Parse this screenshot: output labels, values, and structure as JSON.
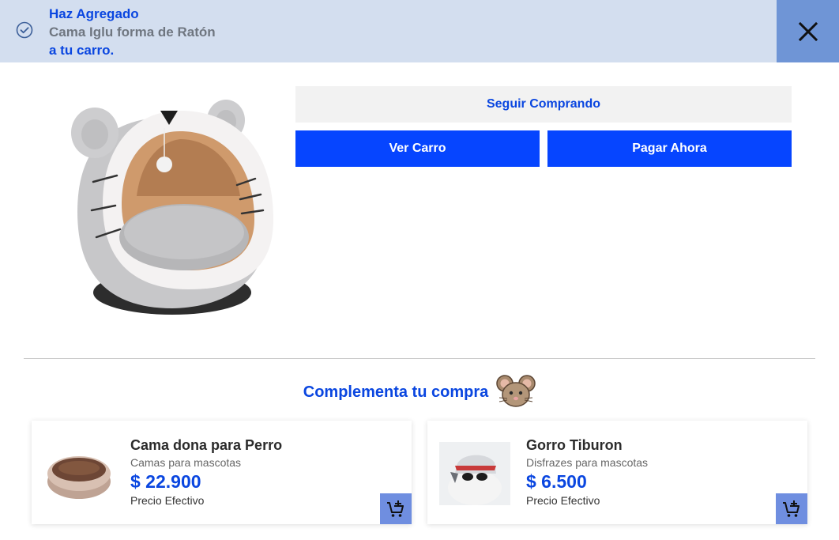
{
  "banner": {
    "added_label": "Haz Agregado",
    "product_name": "Cama Iglu forma de Ratón",
    "to_cart_label": "a tu carro."
  },
  "actions": {
    "continue_label": "Seguir Comprando",
    "view_cart_label": "Ver Carro",
    "pay_now_label": "Pagar Ahora"
  },
  "complement": {
    "title": "Complementa tu compra"
  },
  "products": [
    {
      "name": "Cama dona para Perro",
      "category": "Camas para mascotas",
      "price": "$ 22.900",
      "price_label": "Precio Efectivo"
    },
    {
      "name": "Gorro Tiburon",
      "category": "Disfrazes para mascotas",
      "price": "$ 6.500",
      "price_label": "Precio Efectivo"
    }
  ],
  "colors": {
    "banner_bg": "#d3deef",
    "accent_blue": "#0645ff",
    "text_blue": "#0a46e0",
    "close_bg": "#6f95d6",
    "add_btn_bg": "#6f8ee0"
  },
  "icons": [
    "check-circle-icon",
    "close-icon",
    "mouse-icon",
    "add-to-cart-icon"
  ]
}
